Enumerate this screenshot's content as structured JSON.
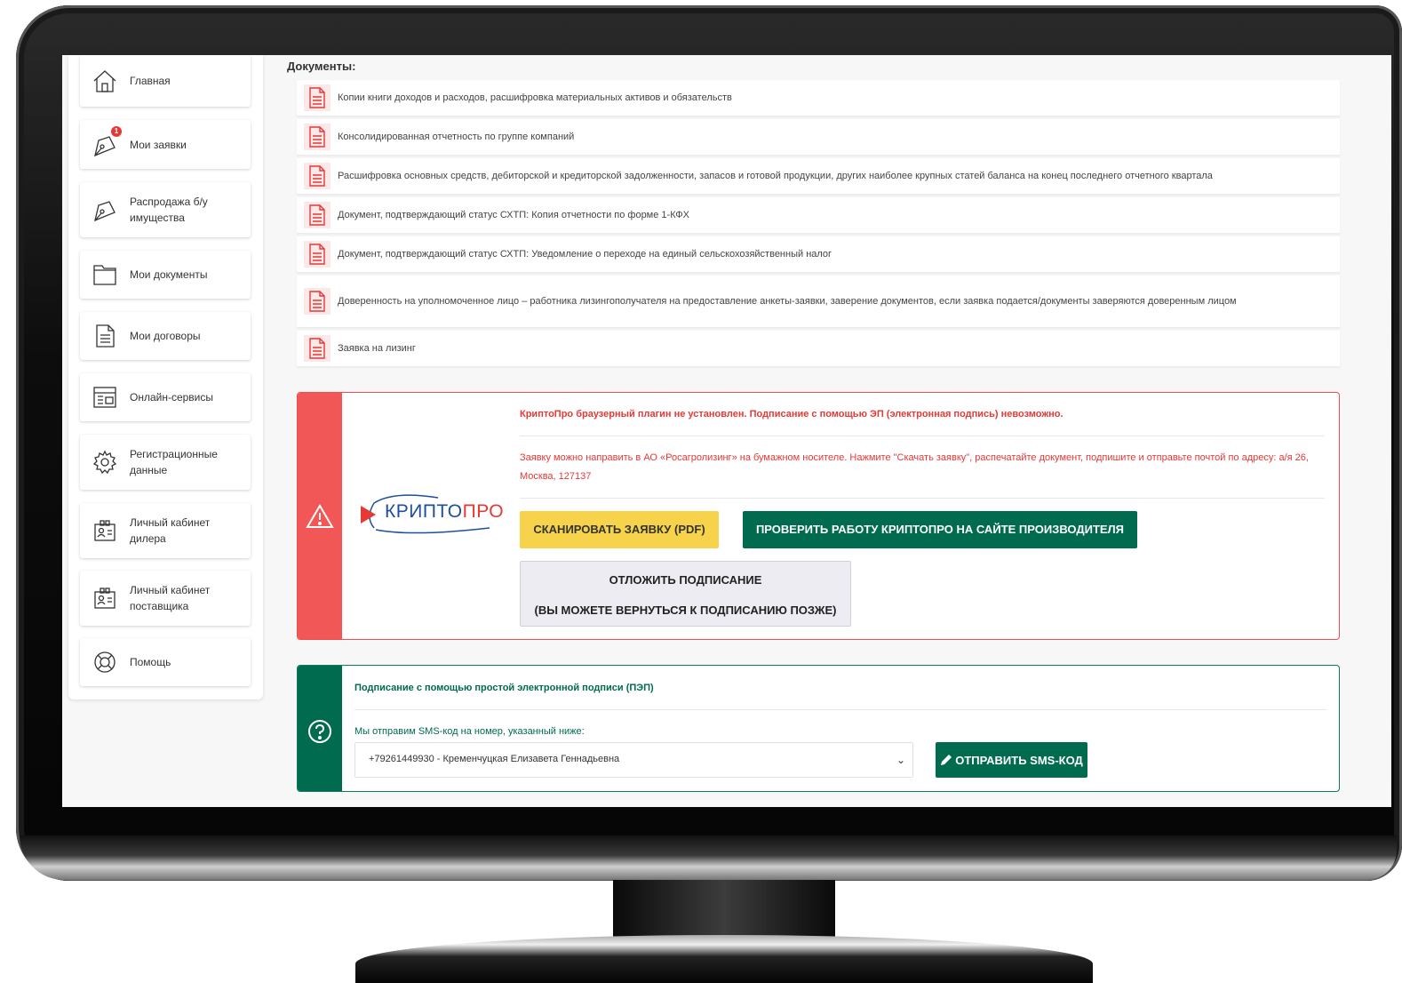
{
  "sidebar": {
    "items": [
      {
        "label": "Главная",
        "icon": "home-icon"
      },
      {
        "label": "Мои заявки",
        "icon": "pen-icon",
        "badge": "1"
      },
      {
        "label": "Распродажа б/у имущества",
        "icon": "pen-icon"
      },
      {
        "label": "Мои документы",
        "icon": "folder-icon"
      },
      {
        "label": "Мои договоры",
        "icon": "document-icon"
      },
      {
        "label": "Онлайн-сервисы",
        "icon": "browser-icon"
      },
      {
        "label": "Регистрационные данные",
        "icon": "gear-icon"
      },
      {
        "label": "Личный кабинет дилера",
        "icon": "id-card-icon"
      },
      {
        "label": "Личный кабинет поставщика",
        "icon": "id-card-icon"
      },
      {
        "label": "Помощь",
        "icon": "lifebuoy-icon"
      }
    ]
  },
  "documents": {
    "title": "Документы:",
    "items": [
      "Копии книги доходов и расходов, расшифровка материальных активов и обязательств",
      "Консолидированная отчетность по группе компаний",
      "Расшифровка основных средств, дебиторской и кредиторской задолженности, запасов и готовой продукции, других наиболее крупных статей баланса на конец последнего отчетного квартала",
      "Документ, подтверждающий статус СХТП: Копия отчетности по форме 1-КФХ",
      "Документ, подтверждающий статус СХТП: Уведомление о переходе на единый сельскохозяйственный налог",
      "Доверенность на уполномоченное лицо – работника лизингополучателя на предоставление анкеты-заявки, заверение документов, если заявка подается/документы заверяются доверенным лицом",
      "Заявка на лизинг"
    ]
  },
  "crypto": {
    "logo_text_main": "КРИПТО",
    "logo_text_accent": "ПРО",
    "title": "КриптоПро браузерный плагин не установлен. Подписание с помощью ЭП (электронная подпись) невозможно.",
    "message": "Заявку можно направить в АО «Росагролизинг» на бумажном носителе. Нажмите \"Скачать заявку\", распечатайте документ, подпишите и отправьте почтой по адресу: а/я 26, Москва, 127137",
    "scan_button": "СКАНИРОВАТЬ ЗАЯВКУ (PDF)",
    "check_button": "ПРОВЕРИТЬ РАБОТУ КРИПТОПРО НА САЙТЕ ПРОИЗВОДИТЕЛЯ",
    "postpone_line1": "ОТЛОЖИТЬ ПОДПИСАНИЕ",
    "postpone_line2": "(ВЫ МОЖЕТЕ ВЕРНУТЬСЯ К ПОДПИСАНИЮ ПОЗЖЕ)",
    "accent_color": "#f25757"
  },
  "pep": {
    "title": "Подписание с помощью простой электронной подписи (ПЭП)",
    "label": "Мы отправим SMS-код на номер, указанный ниже:",
    "selected_value": "+79261449930 - Кременчуцкая Елизавета Геннадьевна",
    "send_button": "ОТПРАВИТЬ SMS-КОД",
    "accent_color": "#006b4f"
  }
}
